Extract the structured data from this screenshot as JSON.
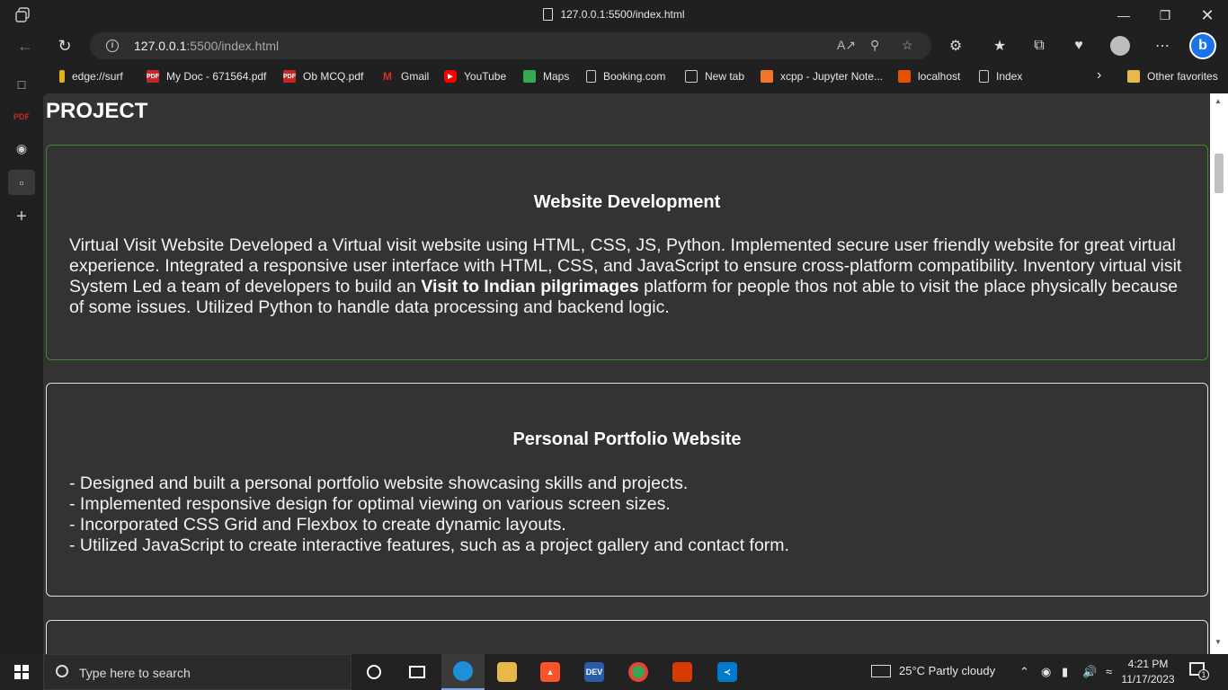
{
  "window": {
    "title": "127.0.0.1:5500/index.html"
  },
  "address_bar": {
    "url_host": "127.0.0.1",
    "url_rest": ":5500/index.html"
  },
  "favorites": [
    {
      "label": "edge://surf",
      "icon": "surf-icon",
      "color": "#e0b020"
    },
    {
      "label": "My Doc - 671564.pdf",
      "icon": "pdf-icon",
      "color": "#c62828"
    },
    {
      "label": "Ob MCQ.pdf",
      "icon": "pdf-icon",
      "color": "#c62828"
    },
    {
      "label": "Gmail",
      "icon": "gmail-icon",
      "color": "#d93025"
    },
    {
      "label": "YouTube",
      "icon": "youtube-icon",
      "color": "#ff0000"
    },
    {
      "label": "Maps",
      "icon": "maps-icon",
      "color": "#34a853"
    },
    {
      "label": "Booking.com",
      "icon": "page-icon",
      "color": "#555555"
    },
    {
      "label": "New tab",
      "icon": "newtab-icon",
      "color": "#555555"
    },
    {
      "label": "xcpp - Jupyter Note...",
      "icon": "jupyter-icon",
      "color": "#f37626"
    },
    {
      "label": "localhost",
      "icon": "localhost-icon",
      "color": "#e65100"
    },
    {
      "label": "Index",
      "icon": "page-icon",
      "color": "#555555"
    }
  ],
  "other_favorites": "Other favorites",
  "page": {
    "heading": "PROJECT",
    "cards": [
      {
        "title": "Website Development",
        "text_before": "Virtual Visit Website Developed a Virtual visit website using HTML, CSS, JS, Python. Implemented secure user friendly website for great virtual experience. Integrated a responsive user interface with HTML, CSS, and JavaScript to ensure cross-platform compatibility. Inventory virtual visit System Led a team of developers to build an ",
        "text_bold": "Visit to Indian pilgrimages",
        "text_after": " platform for people thos not able to visit the place physically because of some issues. Utilized Python to handle data processing and backend logic."
      },
      {
        "title": "Personal Portfolio Website",
        "lines": [
          "- Designed and built a personal portfolio website showcasing skills and projects.",
          "- Implemented responsive design for optimal viewing on various screen sizes.",
          "- Incorporated CSS Grid and Flexbox to create dynamic layouts.",
          "- Utilized JavaScript to create interactive features, such as a project gallery and contact form."
        ]
      }
    ]
  },
  "taskbar": {
    "search_placeholder": "Type here to search",
    "weather": "25°C  Partly cloudy",
    "time": "4:21 PM",
    "date": "11/17/2023",
    "notification_count": "1"
  }
}
